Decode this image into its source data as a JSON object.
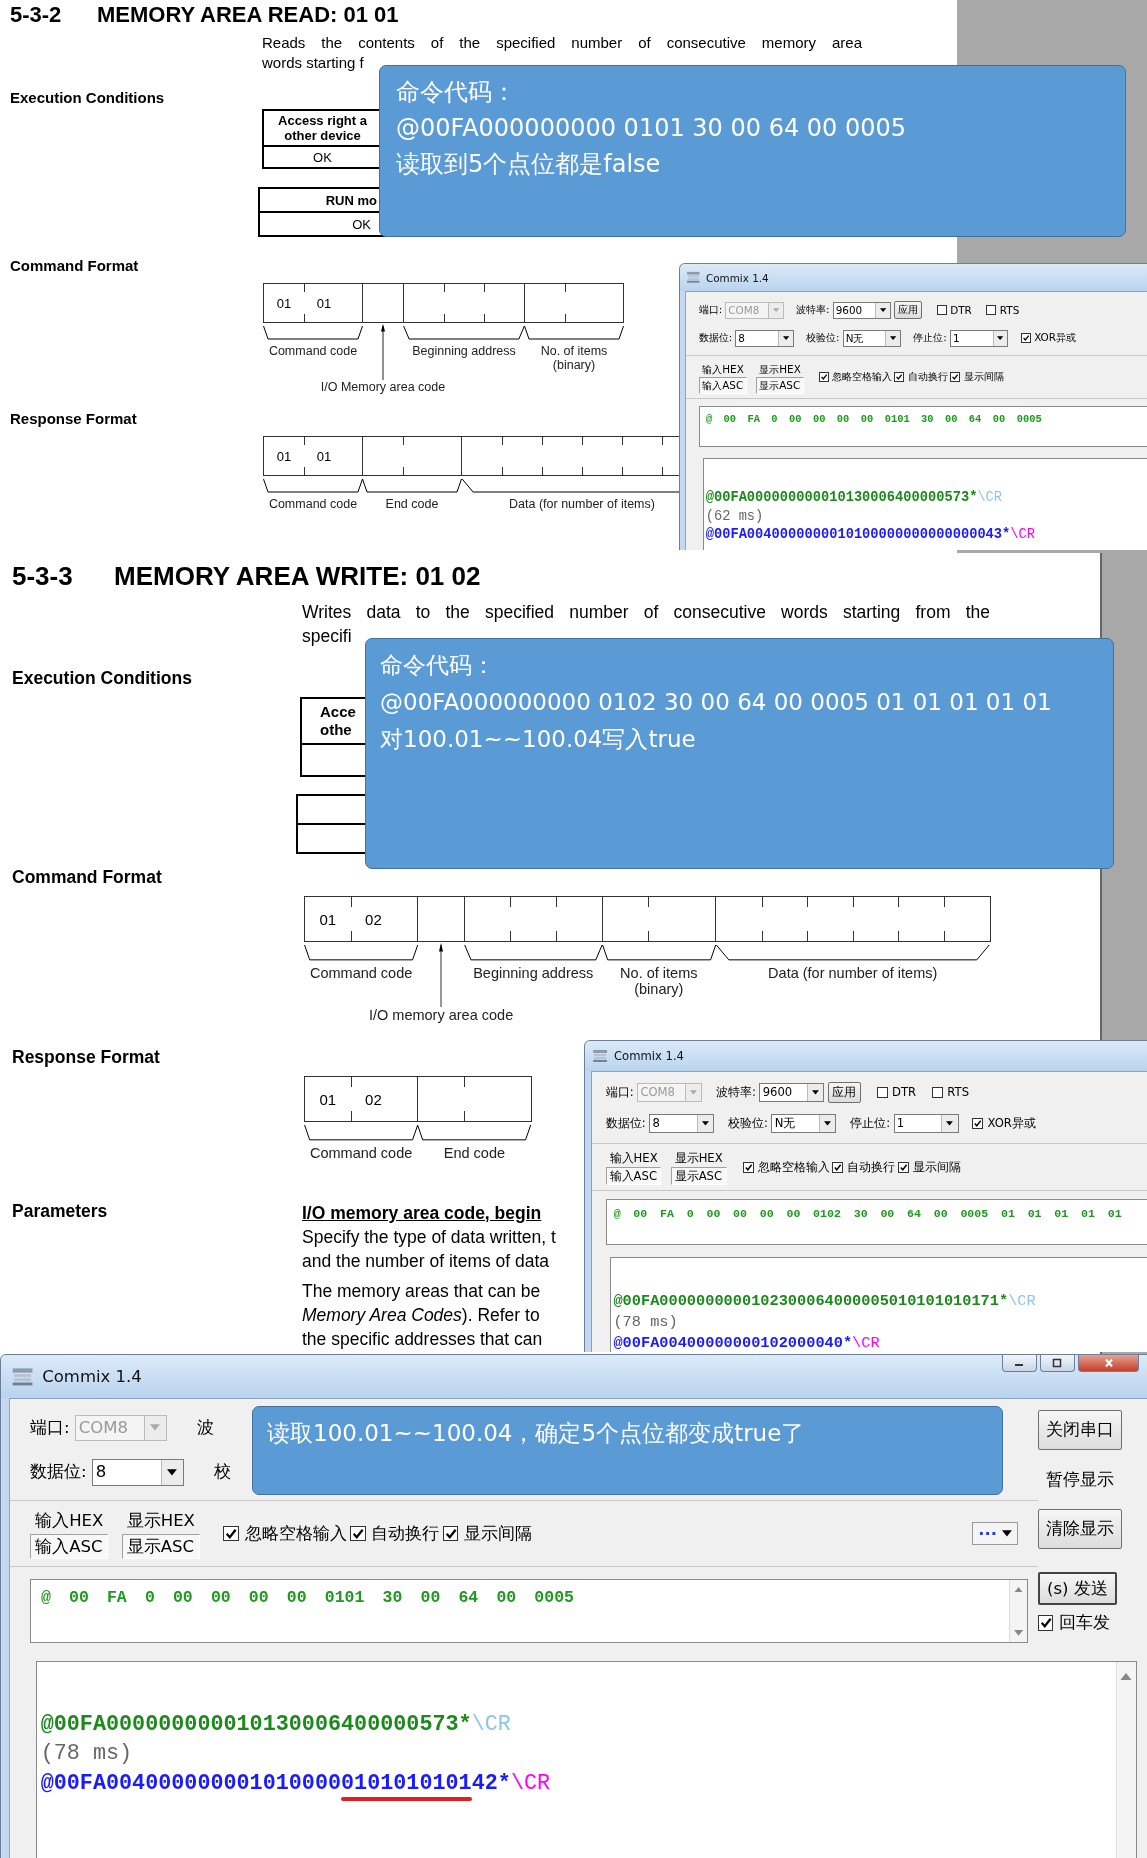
{
  "sections": [
    {
      "number": "5-3-2",
      "title": "MEMORY AREA READ: 01 01",
      "description": [
        "Reads the contents of the specified number of consecutive memory area",
        "words starting f"
      ],
      "rows": [
        {
          "label": "Execution Conditions",
          "kind": "tables",
          "tables": [
            {
              "kind": "labeled",
              "header_lines": [
                "Access right a",
                "other device"
              ],
              "value": "OK"
            },
            {
              "kind": "labeled",
              "header_lines": [
                "RUN mo"
              ],
              "value": "OK"
            }
          ]
        },
        {
          "label": "Command Format",
          "kind": "diagram",
          "fields": [
            {
              "kind": "command_code",
              "values": [
                "01",
                "01"
              ],
              "label": "Command code"
            },
            {
              "kind": "area_code",
              "label": "I/O Memory area code"
            },
            {
              "kind": "address",
              "label": "Beginning address"
            },
            {
              "kind": "count",
              "label": "No. of items (binary)"
            }
          ]
        },
        {
          "label": "Response Format",
          "kind": "diagram",
          "fields": [
            {
              "kind": "command_code",
              "values": [
                "01",
                "01"
              ],
              "label": "Command code"
            },
            {
              "kind": "end_code",
              "label": "End code"
            },
            {
              "kind": "data",
              "label": "Data (for number of items)"
            }
          ]
        }
      ]
    },
    {
      "number": "5-3-3",
      "title": "MEMORY AREA WRITE: 01 02",
      "description": [
        "Writes data to the specified number of consecutive words starting from the",
        "specifi"
      ],
      "rows": [
        {
          "label": "Execution Conditions",
          "kind": "tables",
          "tables": [
            {
              "kind": "labeled",
              "header_lines": [
                "Acce",
                "othe"
              ]
            },
            {
              "kind": "blank"
            }
          ]
        },
        {
          "label": "Command Format",
          "kind": "diagram",
          "fields": [
            {
              "kind": "command_code",
              "values": [
                "01",
                "02"
              ],
              "label": "Command code"
            },
            {
              "kind": "area_code",
              "label": "I/O memory area code"
            },
            {
              "kind": "address",
              "label": "Beginning address"
            },
            {
              "kind": "count",
              "label": "No. of items (binary)"
            },
            {
              "kind": "data",
              "label": "Data (for number of items)"
            }
          ]
        },
        {
          "label": "Response Format",
          "kind": "diagram",
          "fields": [
            {
              "kind": "command_code",
              "values": [
                "01",
                "02"
              ],
              "label": "Command code"
            },
            {
              "kind": "end_code",
              "label": "End code"
            }
          ]
        },
        {
          "label": "Parameters",
          "kind": "params",
          "heading": "I/O memory area code, begin",
          "paragraphs": [
            [
              "Specify the type of data written, t",
              "and the number of items of data"
            ],
            [
              "The memory areas that can be",
              "*Memory Area Codes*). Refer to",
              "the specific addresses that can"
            ]
          ]
        }
      ]
    }
  ],
  "windows": [
    {
      "title": "Commix 1.4",
      "settings": [
        [
          {
            "kind": "combo",
            "label": "端口:",
            "value": "COM8",
            "disabled": true
          },
          {
            "kind": "combo",
            "label": "波特率:",
            "value": "9600",
            "disabled": false
          },
          {
            "kind": "button",
            "label": "应用"
          },
          {
            "kind": "check",
            "label": "DTR",
            "checked": false
          },
          {
            "kind": "check",
            "label": "RTS",
            "checked": false
          }
        ],
        [
          {
            "kind": "combo",
            "label": "数据位:",
            "value": "8",
            "disabled": false
          },
          {
            "kind": "combo",
            "label": "校验位:",
            "value": "N无",
            "disabled": false
          },
          {
            "kind": "combo",
            "label": "停止位:",
            "value": "1",
            "disabled": false
          },
          {
            "kind": "check",
            "label": "XOR异或",
            "checked": true
          }
        ]
      ],
      "input_modes": [
        {
          "label": "输入HEX",
          "selected": false
        },
        {
          "label": "输入ASC",
          "selected": true
        }
      ],
      "display_modes": [
        {
          "label": "显示HEX",
          "selected": false
        },
        {
          "label": "显示ASC",
          "selected": true
        }
      ],
      "options": [
        {
          "label": "忽略空格输入",
          "checked": true
        },
        {
          "label": "自动换行",
          "checked": true
        },
        {
          "label": "显示间隔",
          "checked": true
        }
      ],
      "input": "@ 00 FA 0 00 00 00 00 0101 30 00 64 00 0005",
      "log": [
        {
          "kind": "sent",
          "parts": [
            {
              "text": "@00FA000000000010130006400000573*",
              "underlined": false
            }
          ],
          "suffix": "\\CR"
        },
        {
          "kind": "time",
          "parts": [
            {
              "text": "(62 ms)",
              "underlined": false
            }
          ]
        },
        {
          "kind": "recv",
          "parts": [
            {
              "text": "@00FA0040000000010100000000000000043*",
              "underlined": false
            }
          ],
          "suffix": "\\CR"
        }
      ]
    },
    {
      "title": "Commix 1.4",
      "settings": [
        [
          {
            "kind": "combo",
            "label": "端口:",
            "value": "COM8",
            "disabled": true
          },
          {
            "kind": "combo",
            "label": "波特率:",
            "value": "9600",
            "disabled": false
          },
          {
            "kind": "button",
            "label": "应用"
          },
          {
            "kind": "check",
            "label": "DTR",
            "checked": false
          },
          {
            "kind": "check",
            "label": "RTS",
            "checked": false
          }
        ],
        [
          {
            "kind": "combo",
            "label": "数据位:",
            "value": "8",
            "disabled": false
          },
          {
            "kind": "combo",
            "label": "校验位:",
            "value": "N无",
            "disabled": false
          },
          {
            "kind": "combo",
            "label": "停止位:",
            "value": "1",
            "disabled": false
          },
          {
            "kind": "check",
            "label": "XOR异或",
            "checked": true
          }
        ]
      ],
      "input_modes": [
        {
          "label": "输入HEX",
          "selected": false
        },
        {
          "label": "输入ASC",
          "selected": true
        }
      ],
      "display_modes": [
        {
          "label": "显示HEX",
          "selected": false
        },
        {
          "label": "显示ASC",
          "selected": true
        }
      ],
      "options": [
        {
          "label": "忽略空格输入",
          "checked": true
        },
        {
          "label": "自动换行",
          "checked": true
        },
        {
          "label": "显示间隔",
          "checked": true
        }
      ],
      "input": "@ 00 FA 0 00 00 00 00 0102 30 00 64 00 0005 01 01 01 01 01",
      "log": [
        {
          "kind": "sent",
          "parts": [
            {
              "text": "@00FA0000000000102300064000005010101010171*",
              "underlined": false
            }
          ],
          "suffix": "\\CR"
        },
        {
          "kind": "time",
          "parts": [
            {
              "text": "(78 ms)",
              "underlined": false
            }
          ]
        },
        {
          "kind": "recv",
          "parts": [
            {
              "text": "@00FA00400000000102000040*",
              "underlined": false
            }
          ],
          "suffix": "\\CR"
        }
      ]
    },
    {
      "title": "Commix 1.4",
      "window_controls": true,
      "scrollbars": true,
      "more_button": "···",
      "settings": [
        [
          {
            "kind": "combo",
            "label": "端口:",
            "value": "COM8",
            "disabled": true
          },
          {
            "kind": "label",
            "label": "波"
          }
        ],
        [
          {
            "kind": "combo",
            "label": "数据位:",
            "value": "8",
            "disabled": false
          },
          {
            "kind": "label",
            "label": "校"
          }
        ]
      ],
      "input_modes": [
        {
          "label": "输入HEX",
          "selected": false
        },
        {
          "label": "输入ASC",
          "selected": true
        }
      ],
      "display_modes": [
        {
          "label": "显示HEX",
          "selected": false
        },
        {
          "label": "显示ASC",
          "selected": true
        }
      ],
      "options": [
        {
          "label": "忽略空格输入",
          "checked": true
        },
        {
          "label": "自动换行",
          "checked": true
        },
        {
          "label": "显示间隔",
          "checked": true
        }
      ],
      "input": "@ 00 FA 0 00 00 00 00 0101 30 00 64 00 0005",
      "side_buttons": [
        {
          "kind": "button",
          "label": "关闭串口"
        },
        {
          "kind": "flat",
          "label": "暂停显示"
        },
        {
          "kind": "button",
          "label": "清除显示"
        },
        {
          "kind": "send",
          "label": "(s) 发送"
        },
        {
          "kind": "check",
          "label": "回车发",
          "checked": true
        }
      ],
      "log": [
        {
          "kind": "sent",
          "parts": [
            {
              "text": "@00FA000000000010130006400000573*",
              "underlined": false
            }
          ],
          "suffix": "\\CR"
        },
        {
          "kind": "time",
          "parts": [
            {
              "text": "(78 ms)",
              "underlined": false
            }
          ]
        },
        {
          "kind": "recv",
          "parts": [
            {
              "text": "@00FA004000000001010000",
              "underlined": false
            },
            {
              "text": "0101010101",
              "underlined": true
            },
            {
              "text": "42*",
              "underlined": false
            }
          ],
          "suffix": "\\CR"
        }
      ]
    }
  ],
  "callouts": [
    {
      "lines": [
        "命令代码：",
        "@00FA000000000 0101 30 00 64 00 0005",
        "读取到5个点位都是false"
      ]
    },
    {
      "lines": [
        "命令代码：",
        "@00FA000000000 0102 30 00 64 00 0005 01 01 01 01 01",
        "对100.01~~100.04写入true"
      ]
    },
    {
      "lines": [
        "读取100.01~~100.04，确定5个点位都变成true了"
      ]
    }
  ]
}
